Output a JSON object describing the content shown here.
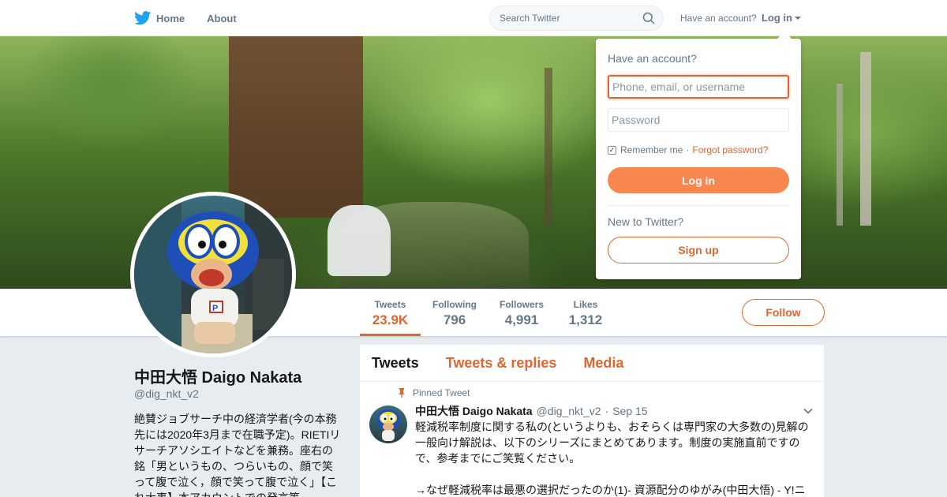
{
  "nav": {
    "home_label": "Home",
    "about_label": "About",
    "search_placeholder": "Search Twitter",
    "have_account": "Have an account?",
    "login_label": "Log in"
  },
  "stats": [
    {
      "label": "Tweets",
      "value": "23.9K"
    },
    {
      "label": "Following",
      "value": "796"
    },
    {
      "label": "Followers",
      "value": "4,991"
    },
    {
      "label": "Likes",
      "value": "1,312"
    }
  ],
  "follow_label": "Follow",
  "profile": {
    "name": "中田大悟 Daigo Nakata",
    "handle": "@dig_nkt_v2",
    "bio": "絶賛ジョブサーチ中の経済学者(今の本務先には2020年3月まで在職予定)。RIETIリサーチアソシエイトなどを兼務。座右の銘「男というもの、つらいもの、顔で笑って腹で泣く，顔で笑って腹で泣く」【これ大事】本アカウントでの発言等"
  },
  "timeline": {
    "tabs": [
      "Tweets",
      "Tweets & replies",
      "Media"
    ]
  },
  "tweet": {
    "pinned_label": "Pinned Tweet",
    "name": "中田大悟 Daigo Nakata",
    "handle": "@dig_nkt_v2",
    "date": "Sep 15",
    "text": "軽減税率制度に関する私の(というよりも、おそらくは専門家の大多数の)見解の一般向け解説は、以下のシリーズにまとめてあります。制度の実施直前ですので、参考までにご笑覧ください。\n\n→なぜ軽減税率は最悪の選択だったのか(1)- 資源配分のゆがみ(中田大悟) - Y!ニ"
  },
  "login_dropdown": {
    "title": "Have an account?",
    "username_placeholder": "Phone, email, or username",
    "password_placeholder": "Password",
    "remember_label": "Remember me",
    "separator": "·",
    "forgot_label": "Forgot password?",
    "login_button": "Log in",
    "new_label": "New to Twitter?",
    "signup_button": "Sign up"
  },
  "colors": {
    "accent": "#e0652e",
    "twitter_blue": "#1da1f2"
  }
}
